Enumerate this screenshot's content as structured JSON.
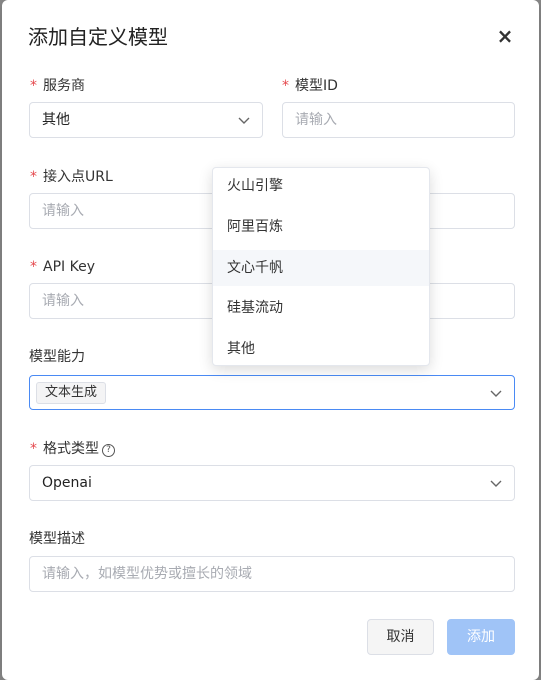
{
  "dialog": {
    "title": "添加自定义模型",
    "close_symbol": "×"
  },
  "fields": {
    "provider": {
      "label": "服务商",
      "required": true,
      "value": "其他"
    },
    "model_id": {
      "label": "模型ID",
      "required": true,
      "placeholder": "请输入"
    },
    "endpoint": {
      "label": "接入点URL",
      "required": true,
      "placeholder": "请输入"
    },
    "api_key": {
      "label": "API Key",
      "required": true,
      "placeholder": "请输入"
    },
    "capability": {
      "label": "模型能力",
      "required": false,
      "tag": "文本生成"
    },
    "format": {
      "label": "格式类型",
      "required": true,
      "help_symbol": "?",
      "value": "Openai"
    },
    "description": {
      "label": "模型描述",
      "required": false,
      "placeholder": "请输入，如模型优势或擅长的领域"
    }
  },
  "provider_dropdown": {
    "options": [
      "火山引擎",
      "阿里百炼",
      "文心千帆",
      "硅基流动",
      "其他"
    ],
    "hovered": "文心千帆"
  },
  "footer": {
    "cancel_label": "取消",
    "add_label": "添加"
  },
  "colors": {
    "required": "#e5484d",
    "primary_disabled": "#a0c4f7",
    "focus_border": "#4a8af4"
  },
  "icons": {
    "close": "close-icon",
    "chevron": "chevron-down-icon",
    "help": "help-circle-icon"
  }
}
